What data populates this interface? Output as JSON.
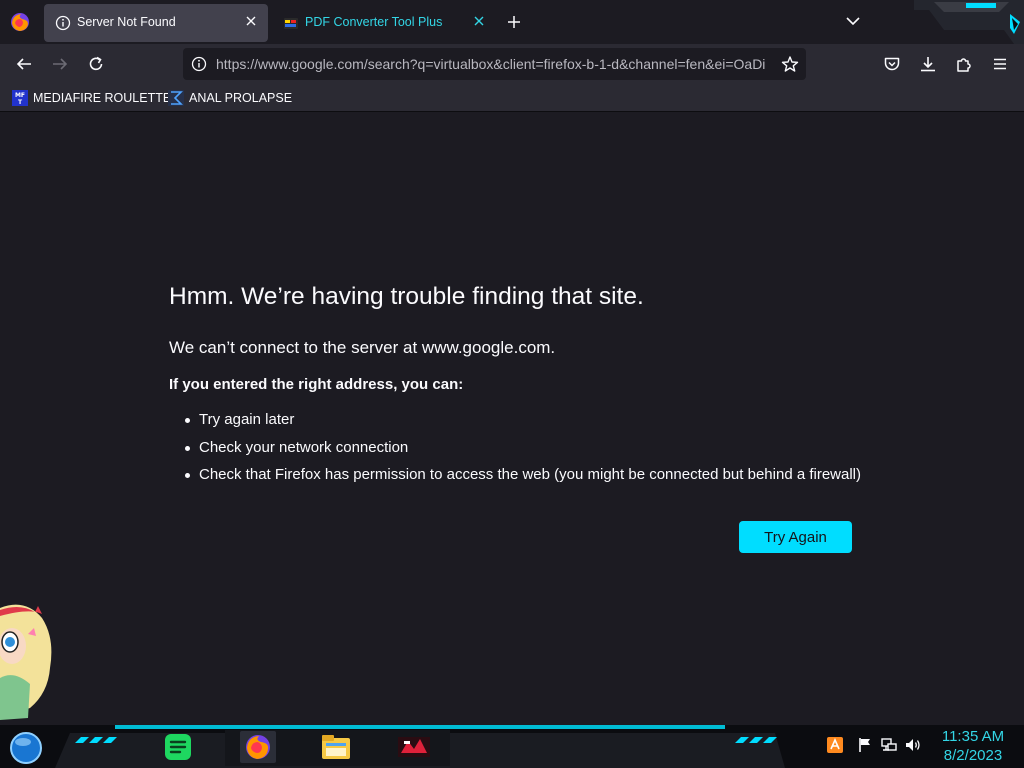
{
  "browser": {
    "tabs": [
      {
        "label": "Server Not Found",
        "active": true,
        "icon": "info-icon"
      },
      {
        "label": "PDF Converter Tool Plus",
        "active": false,
        "icon": "pdf-tool-favicon"
      }
    ],
    "url": "https://www.google.com/search?q=virtualbox&client=firefox-b-1-d&channel=fen&ei=OaDi",
    "bookmarks": [
      {
        "label": "MEDIAFIRE ROULETTER",
        "icon": "mediafire-icon",
        "icon_text": "MF T"
      },
      {
        "label": "ANAL PROLAPSE",
        "icon": "sigma-icon"
      }
    ]
  },
  "error_page": {
    "title": "Hmm. We’re having trouble finding that site.",
    "description": "We can’t connect to the server at www.google.com.",
    "subheading": "If you entered the right address, you can:",
    "suggestions": [
      "Try again later",
      "Check your network connection",
      "Check that Firefox has permission to access the web (you might be connected but behind a firewall)"
    ],
    "button_label": "Try Again"
  },
  "taskbar": {
    "time": "11:35 AM",
    "date": "8/2/2023",
    "apps": [
      "notes-app-icon",
      "firefox-icon",
      "file-explorer-icon",
      "media-app-icon"
    ]
  },
  "colors": {
    "accent": "#00ddff",
    "tab_inactive_text": "#33d6e6",
    "page_bg": "#1c1b22",
    "toolbar_bg": "#2b2a33"
  }
}
